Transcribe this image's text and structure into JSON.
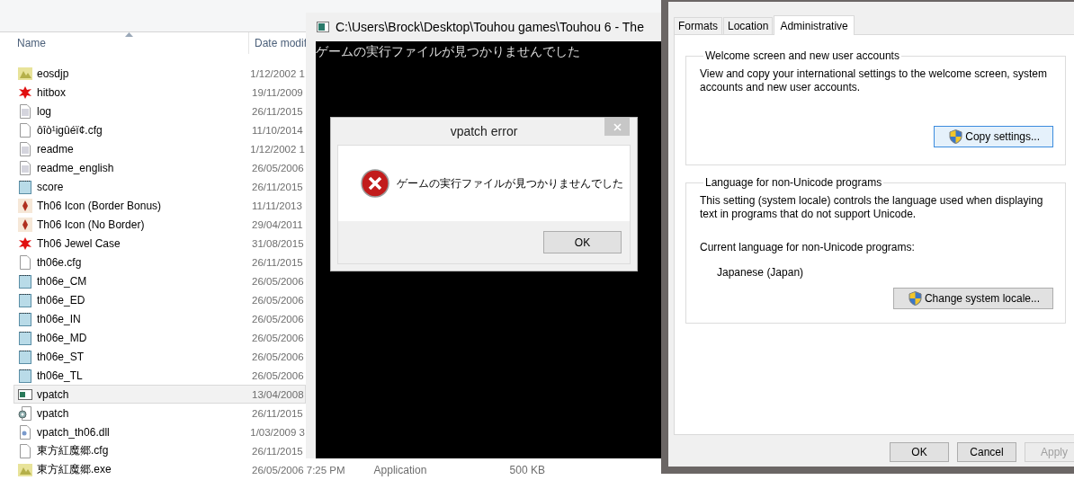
{
  "explorer": {
    "columns": [
      "Name",
      "Date modif"
    ],
    "rows": [
      {
        "name": "eosdjp",
        "date": "1/12/2002 1",
        "kind": "image",
        "selected": false
      },
      {
        "name": "hitbox",
        "date": "19/11/2009",
        "kind": "splat",
        "selected": false
      },
      {
        "name": "log",
        "date": "26/11/2015",
        "kind": "text",
        "selected": false
      },
      {
        "name": "ôîò¹igûéï¢.cfg",
        "date": "11/10/2014",
        "kind": "blank",
        "selected": false
      },
      {
        "name": "readme",
        "date": "1/12/2002 1",
        "kind": "text",
        "selected": false
      },
      {
        "name": "readme_english",
        "date": "26/05/2006",
        "kind": "text",
        "selected": false
      },
      {
        "name": "score",
        "date": "26/11/2015",
        "kind": "notepad",
        "selected": false
      },
      {
        "name": "Th06 Icon (Border Bonus)",
        "date": "11/11/2013",
        "kind": "icon",
        "selected": false
      },
      {
        "name": "Th06 Icon (No Border)",
        "date": "29/04/2011",
        "kind": "icon",
        "selected": false
      },
      {
        "name": "Th06 Jewel Case",
        "date": "31/08/2015",
        "kind": "splat",
        "selected": false
      },
      {
        "name": "th06e.cfg",
        "date": "26/11/2015",
        "kind": "blank",
        "selected": false
      },
      {
        "name": "th06e_CM",
        "date": "26/05/2006",
        "kind": "notepad",
        "selected": false
      },
      {
        "name": "th06e_ED",
        "date": "26/05/2006",
        "kind": "notepad",
        "selected": false
      },
      {
        "name": "th06e_IN",
        "date": "26/05/2006",
        "kind": "notepad",
        "selected": false
      },
      {
        "name": "th06e_MD",
        "date": "26/05/2006",
        "kind": "notepad",
        "selected": false
      },
      {
        "name": "th06e_ST",
        "date": "26/05/2006",
        "kind": "notepad",
        "selected": false
      },
      {
        "name": "th06e_TL",
        "date": "26/05/2006",
        "kind": "notepad",
        "selected": false
      },
      {
        "name": "vpatch",
        "date": "13/04/2008",
        "kind": "program",
        "selected": true
      },
      {
        "name": "vpatch",
        "date": "26/11/2015",
        "kind": "settings",
        "selected": false
      },
      {
        "name": "vpatch_th06.dll",
        "date": "1/03/2009 3",
        "kind": "dll",
        "selected": false
      },
      {
        "name": "東方紅魔郷.cfg",
        "date": "26/11/2015",
        "kind": "blank",
        "selected": false
      },
      {
        "name": "東方紅魔郷.exe",
        "date": "26/05/2006 7:25 PM",
        "type": "Application",
        "size": "500 KB",
        "kind": "image",
        "selected": false
      }
    ]
  },
  "console": {
    "title": "C:\\Users\\Brock\\Desktop\\Touhou games\\Touhou 6 - The",
    "output": "ゲームの実行ファイルが見つかりませんでした"
  },
  "error_dialog": {
    "title": "vpatch error",
    "message": "ゲームの実行ファイルが見つかりませんでした",
    "buttons": [
      "OK"
    ]
  },
  "region_dialog": {
    "tabs": [
      {
        "label": "Formats",
        "selected": false
      },
      {
        "label": "Location",
        "selected": false
      },
      {
        "label": "Administrative",
        "selected": true
      }
    ],
    "groups": [
      {
        "title": "Welcome screen and new user accounts",
        "lines": [
          {
            "kind": "text",
            "text": "View and copy your international settings to the welcome screen, system accounts and new user accounts."
          }
        ],
        "button": {
          "label": "Copy settings...",
          "focused": true
        }
      },
      {
        "title": "Language for non-Unicode programs",
        "lines": [
          {
            "kind": "text",
            "text": "This setting (system locale) controls the language used when displaying text in programs that do not support Unicode."
          },
          {
            "kind": "label",
            "text": "Current language for non-Unicode programs:"
          },
          {
            "kind": "value",
            "text": "Japanese (Japan)"
          }
        ],
        "button": {
          "label": "Change system locale...",
          "focused": false
        }
      }
    ],
    "buttons": [
      {
        "label": "OK",
        "disabled": false
      },
      {
        "label": "Cancel",
        "disabled": false
      },
      {
        "label": "Apply",
        "disabled": true
      }
    ]
  }
}
